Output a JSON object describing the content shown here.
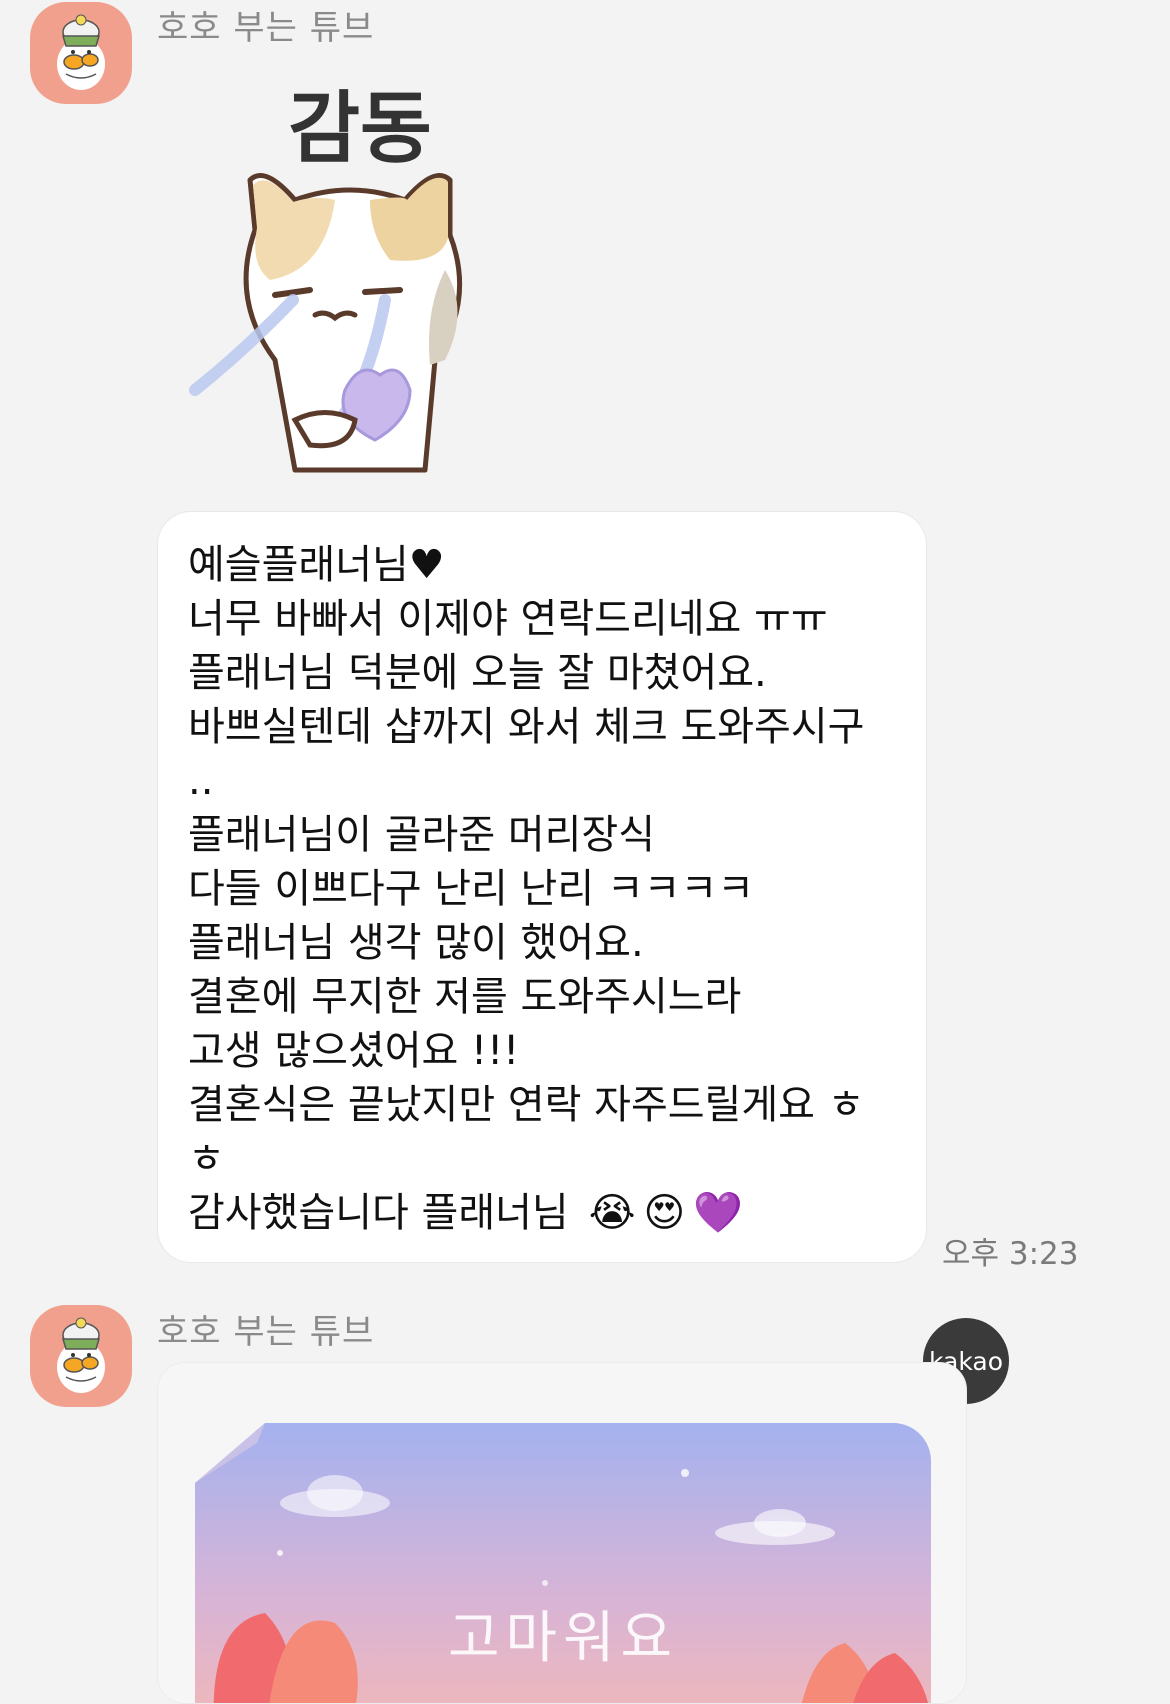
{
  "messages": [
    {
      "sender": "호호 부는 튜브",
      "sticker_caption": "감동"
    },
    {
      "lines": [
        "예슬플래너님♥",
        "너무 바빠서 이제야 연락드리네요 ㅠㅠ",
        "플래너님 덕분에 오늘 잘 마쳤어요.",
        "바쁘실텐데 샵까지 와서 체크 도와주시구",
        "..",
        "플래너님이 골라준 머리장식",
        "다들 이쁘다구 난리 난리 ㅋㅋㅋㅋ",
        "플래너님 생각 많이 했어요.",
        "결혼에 무지한 저를 도와주시느라",
        "고생 많으셨어요 !!!",
        "결혼식은 끝났지만 연락 자주드릴게요 ㅎ",
        "ㅎ"
      ],
      "last_line": "감사했습니다 플래너님",
      "emojis": [
        "😭",
        "😍",
        "💜"
      ],
      "time": "오후 3:23"
    },
    {
      "sender": "호호 부는 튜브",
      "badge": "kakao",
      "card_text": "고마워요"
    }
  ],
  "colors": {
    "background": "#f3f3f3",
    "bubble": "#ffffff",
    "avatar": "#f0a08d",
    "badge": "#3a3a3a"
  }
}
